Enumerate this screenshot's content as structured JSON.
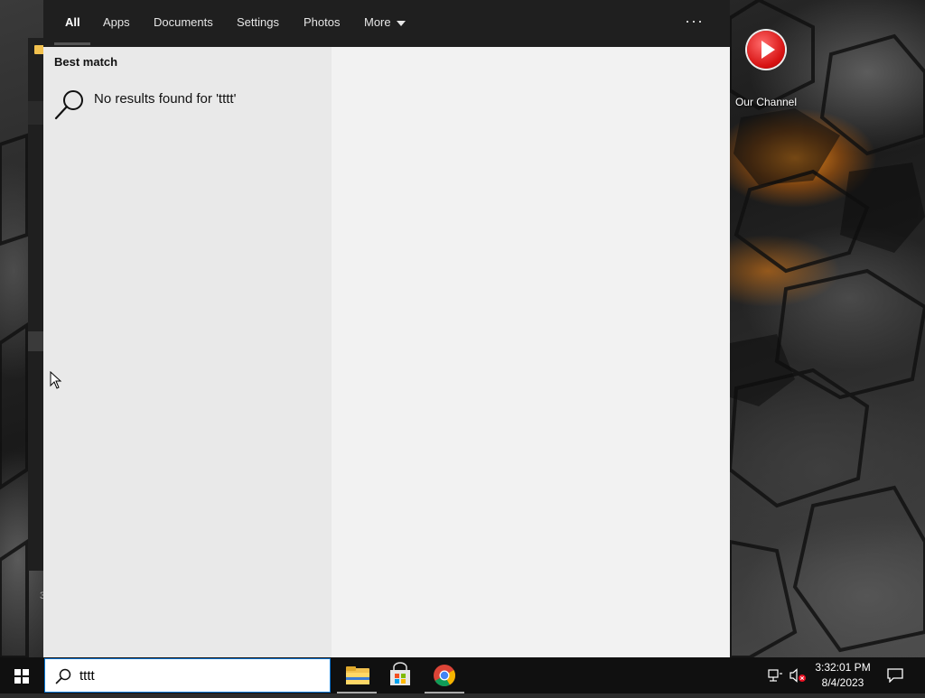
{
  "search_tabs": {
    "all": "All",
    "apps": "Apps",
    "documents": "Documents",
    "settings": "Settings",
    "photos": "Photos",
    "more": "More",
    "options": "···"
  },
  "results": {
    "section_heading": "Best match",
    "no_results_text": "No results found for 'tttt'"
  },
  "taskbar": {
    "search_query": "tttt",
    "apps": [
      "file-explorer",
      "microsoft-store",
      "google-chrome"
    ],
    "clock_time": "3:32:01 PM",
    "clock_date": "8/4/2023"
  },
  "desktop": {
    "shortcut_label": "Our Channel"
  },
  "colors": {
    "accent": "#0078d7",
    "header_bg": "#1f1f1f",
    "results_left_bg": "#e9e9e9",
    "results_right_bg": "#f2f2f2",
    "taskbar_bg": "#101010"
  }
}
